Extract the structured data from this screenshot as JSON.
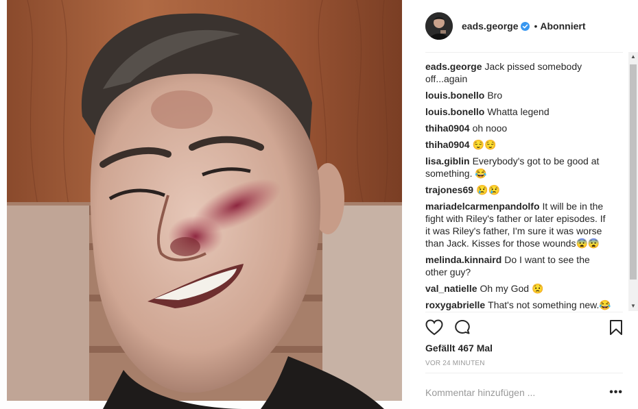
{
  "post": {
    "username": "eads.george",
    "follow_status": "Abonniert",
    "separator": "•"
  },
  "comments": [
    {
      "user": "eads.george",
      "text": "Jack pissed somebody off...again"
    },
    {
      "user": "louis.bonello",
      "text": "Bro"
    },
    {
      "user": "louis.bonello",
      "text": "Whatta legend"
    },
    {
      "user": "thiha0904",
      "text": "oh nooo"
    },
    {
      "user": "thiha0904",
      "text": "😌😌"
    },
    {
      "user": "lisa.giblin",
      "text": "Everybody's got to be good at something. 😂"
    },
    {
      "user": "trajones69",
      "text": "😢😢"
    },
    {
      "user": "mariadelcarmenpandolfo",
      "text": "It will be in the fight with Riley's father or later episodes. If it was Riley's father, I'm sure it was worse than Jack. Kisses for those wounds😨😨"
    },
    {
      "user": "melinda.kinnaird",
      "text": "Do I want to see the other guy?"
    },
    {
      "user": "val_natielle",
      "text": "Oh my God 😟"
    },
    {
      "user": "roxygabrielle",
      "text": "That's not something new.😂"
    }
  ],
  "likes": "Gefällt 467 Mal",
  "timestamp": "VOR 24 MINUTEN",
  "comment_input": {
    "placeholder": "Kommentar hinzufügen ..."
  },
  "more_label": "•••",
  "icons": {
    "like": "heart-icon",
    "comment": "comment-icon",
    "save": "bookmark-icon",
    "verified": "verified-badge-icon"
  },
  "colors": {
    "verified": "#3897f0",
    "text": "#262626",
    "muted": "#999999"
  }
}
